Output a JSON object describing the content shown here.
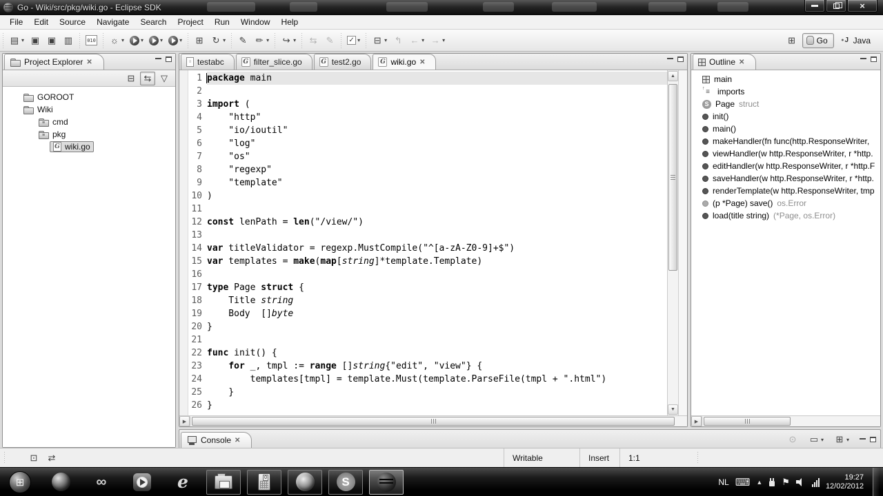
{
  "window": {
    "title": "Go - Wiki/src/pkg/wiki.go - Eclipse SDK"
  },
  "menu_bar": {
    "items": [
      "File",
      "Edit",
      "Source",
      "Navigate",
      "Search",
      "Project",
      "Run",
      "Window",
      "Help"
    ]
  },
  "toolbar": {
    "groups": [
      [
        {
          "name": "new-wizard-button",
          "glyph": "▤",
          "dd": true
        },
        {
          "name": "save-button",
          "glyph": "▣"
        },
        {
          "name": "save-all-button",
          "glyph": "▣"
        },
        {
          "name": "print-button",
          "glyph": "▥"
        }
      ],
      [
        {
          "name": "binary-file-button",
          "glyph": "010",
          "binary": true
        }
      ],
      [
        {
          "name": "debug-button",
          "glyph": "☼",
          "dd": true
        },
        {
          "name": "run-button",
          "run": true,
          "dd": true
        },
        {
          "name": "run-history-button",
          "run": true,
          "dd": true
        },
        {
          "name": "run-last-button",
          "run": true,
          "dd": true
        }
      ],
      [
        {
          "name": "new-go-project-button",
          "glyph": "⊞"
        },
        {
          "name": "go-build-button",
          "glyph": "↻",
          "dd": true
        }
      ],
      [
        {
          "name": "open-resource-button",
          "glyph": "✎"
        },
        {
          "name": "mark-occurrences-button",
          "glyph": "✏",
          "dd": true
        }
      ],
      [
        {
          "name": "next-annotation-button",
          "glyph": "↪",
          "dd": true
        }
      ],
      [
        {
          "name": "refresh-button",
          "glyph": "⇆",
          "disabled": true
        },
        {
          "name": "format-button",
          "glyph": "✎",
          "disabled": true
        }
      ],
      [
        {
          "name": "run-checklist-button",
          "glyph": "✓",
          "check": true,
          "dd": true
        }
      ],
      [
        {
          "name": "type-hierarchy-button",
          "glyph": "⊟",
          "dd": true
        },
        {
          "name": "last-edit-location-button",
          "glyph": "↰",
          "disabled": true
        },
        {
          "name": "back-button",
          "glyph": "←",
          "disabled": true,
          "dd": true
        },
        {
          "name": "forward-button",
          "glyph": "→",
          "disabled": true,
          "dd": true
        }
      ]
    ],
    "dropdown_glyph": "▾"
  },
  "perspective_bar": {
    "go_label": "Go",
    "java_label": "Java"
  },
  "project_explorer": {
    "title": "Project Explorer",
    "toolbar": [
      {
        "name": "collapse-all-button",
        "glyph": "⊟"
      },
      {
        "name": "link-with-editor-button",
        "glyph": "⇆",
        "pressed": true
      },
      {
        "name": "view-menu-button",
        "glyph": "▽"
      }
    ],
    "tree": [
      {
        "label": "GOROOT",
        "icon": "folder",
        "indent": 0
      },
      {
        "label": "Wiki",
        "icon": "folder",
        "indent": 0
      },
      {
        "label": "cmd",
        "icon": "pkg-folder",
        "indent": 1
      },
      {
        "label": "pkg",
        "icon": "pkg-folder",
        "indent": 1
      },
      {
        "label": "wiki.go",
        "icon": "go-file",
        "indent": 2,
        "selected": true
      }
    ]
  },
  "editor": {
    "tabs": [
      {
        "label": "testabc",
        "icon": "file",
        "active": false
      },
      {
        "label": "filter_slice.go",
        "icon": "go",
        "active": false
      },
      {
        "label": "test2.go",
        "icon": "go",
        "active": false
      },
      {
        "label": "wiki.go",
        "icon": "go",
        "active": true,
        "close": "✕"
      }
    ],
    "lines": [
      {
        "n": 1,
        "hl": true,
        "cursor": true,
        "segs": [
          [
            "package",
            "b"
          ],
          [
            " main",
            ""
          ]
        ]
      },
      {
        "n": 2,
        "segs": []
      },
      {
        "n": 3,
        "segs": [
          [
            "import",
            "b"
          ],
          [
            " (",
            ""
          ]
        ]
      },
      {
        "n": 4,
        "segs": [
          [
            "    \"http\"",
            ""
          ]
        ]
      },
      {
        "n": 5,
        "segs": [
          [
            "    \"io/ioutil\"",
            ""
          ]
        ]
      },
      {
        "n": 6,
        "segs": [
          [
            "    \"log\"",
            ""
          ]
        ]
      },
      {
        "n": 7,
        "segs": [
          [
            "    \"os\"",
            ""
          ]
        ]
      },
      {
        "n": 8,
        "segs": [
          [
            "    \"regexp\"",
            ""
          ]
        ]
      },
      {
        "n": 9,
        "segs": [
          [
            "    \"template\"",
            ""
          ]
        ]
      },
      {
        "n": 10,
        "segs": [
          [
            ")",
            ""
          ]
        ]
      },
      {
        "n": 11,
        "segs": []
      },
      {
        "n": 12,
        "segs": [
          [
            "const",
            "b"
          ],
          [
            " lenPath = ",
            ""
          ],
          [
            "len",
            "b"
          ],
          [
            "(\"/view/\")",
            ""
          ]
        ]
      },
      {
        "n": 13,
        "segs": []
      },
      {
        "n": 14,
        "segs": [
          [
            "var",
            "b"
          ],
          [
            " titleValidator = regexp.MustCompile(\"^[a-zA-Z0-9]+$\")",
            ""
          ]
        ]
      },
      {
        "n": 15,
        "segs": [
          [
            "var",
            "b"
          ],
          [
            " templates = ",
            ""
          ],
          [
            "make",
            "b"
          ],
          [
            "(",
            ""
          ],
          [
            "map",
            "b"
          ],
          [
            "[",
            ""
          ],
          [
            "string",
            "i"
          ],
          [
            "]*template.Template)",
            ""
          ]
        ]
      },
      {
        "n": 16,
        "segs": []
      },
      {
        "n": 17,
        "segs": [
          [
            "type",
            "b"
          ],
          [
            " Page ",
            ""
          ],
          [
            "struct",
            "b"
          ],
          [
            " {",
            ""
          ]
        ]
      },
      {
        "n": 18,
        "segs": [
          [
            "    Title ",
            ""
          ],
          [
            "string",
            "i"
          ]
        ]
      },
      {
        "n": 19,
        "segs": [
          [
            "    Body  []",
            ""
          ],
          [
            "byte",
            "i"
          ]
        ]
      },
      {
        "n": 20,
        "segs": [
          [
            "}",
            ""
          ]
        ]
      },
      {
        "n": 21,
        "segs": []
      },
      {
        "n": 22,
        "segs": [
          [
            "func",
            "b"
          ],
          [
            " init() {",
            ""
          ]
        ]
      },
      {
        "n": 23,
        "segs": [
          [
            "    ",
            ""
          ],
          [
            "for",
            "b"
          ],
          [
            " _, tmpl := ",
            ""
          ],
          [
            "range",
            "b"
          ],
          [
            " []",
            ""
          ],
          [
            "string",
            "i"
          ],
          [
            "{\"edit\", \"view\"} {",
            ""
          ]
        ]
      },
      {
        "n": 24,
        "segs": [
          [
            "        templates[tmpl] = template.Must(template.ParseFile(tmpl + \".html\")",
            ""
          ]
        ]
      },
      {
        "n": 25,
        "segs": [
          [
            "    }",
            ""
          ]
        ]
      },
      {
        "n": 26,
        "segs": [
          [
            "}",
            ""
          ]
        ]
      }
    ]
  },
  "outline": {
    "title": "Outline",
    "items": [
      {
        "label": "main",
        "icon": "grid"
      },
      {
        "label": "imports",
        "icon": "imports"
      },
      {
        "label": "Page",
        "suffix": " struct",
        "icon": "struct"
      },
      {
        "label": "init()",
        "icon": "func"
      },
      {
        "label": "main()",
        "icon": "func"
      },
      {
        "label": "makeHandler(fn func(http.ResponseWriter,",
        "icon": "func"
      },
      {
        "label": "viewHandler(w http.ResponseWriter, r *http.",
        "icon": "func"
      },
      {
        "label": "editHandler(w http.ResponseWriter, r *http.F",
        "icon": "func"
      },
      {
        "label": "saveHandler(w http.ResponseWriter, r *http.",
        "icon": "func"
      },
      {
        "label": "renderTemplate(w http.ResponseWriter, tmp",
        "icon": "func"
      },
      {
        "label": "(p *Page) save()",
        "suffix": " os.Error",
        "icon": "func-gray"
      },
      {
        "label": "load(title string)",
        "suffix": " (*Page, os.Error)",
        "icon": "func"
      }
    ]
  },
  "console": {
    "title": "Console",
    "toolbar": [
      {
        "name": "pin-console-button",
        "glyph": "⊙",
        "disabled": true
      },
      {
        "name": "display-console-button",
        "glyph": "▭",
        "dd": true
      },
      {
        "name": "open-console-button",
        "glyph": "⊞",
        "dd": true
      }
    ]
  },
  "status_bar": {
    "writable": "Writable",
    "insert_mode": "Insert",
    "cursor_position": "1:1"
  },
  "taskbar": {
    "apps": [
      {
        "name": "start-button",
        "icon": "start"
      },
      {
        "name": "taskbar-network-sphere",
        "icon": "sphere"
      },
      {
        "name": "taskbar-visual-studio",
        "icon": "infinity"
      },
      {
        "name": "taskbar-media-player",
        "icon": "wmp"
      },
      {
        "name": "taskbar-internet-explorer",
        "icon": "ie"
      },
      {
        "name": "taskbar-windows-explorer",
        "icon": "explorer",
        "boxed": true
      },
      {
        "name": "taskbar-calculator",
        "icon": "calc",
        "boxed": true
      },
      {
        "name": "taskbar-firefox",
        "icon": "firefox",
        "boxed": true
      },
      {
        "name": "taskbar-skype",
        "icon": "skype",
        "boxed": true,
        "glyph": "S"
      },
      {
        "name": "taskbar-eclipse",
        "icon": "eclipse",
        "boxed": true,
        "active": true
      }
    ],
    "tray": {
      "language": "NL",
      "time": "19:27",
      "date": "12/02/2012"
    }
  },
  "colors": {
    "titlebar_dark": "#262626",
    "panel_border": "#8f8f8f",
    "line_highlight": "#e6e6e6",
    "taskbar_black": "#000000"
  }
}
